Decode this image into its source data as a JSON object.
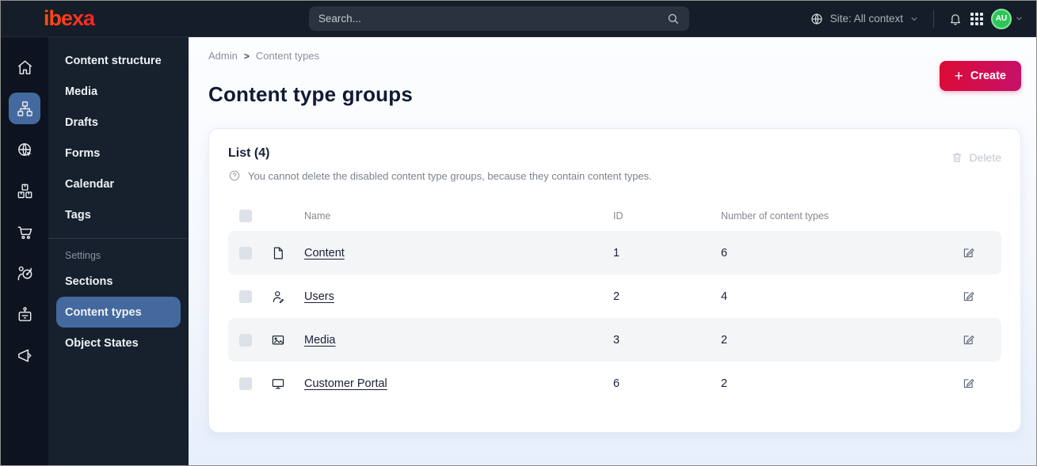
{
  "topbar": {
    "logo": "ibexa",
    "search_placeholder": "Search...",
    "site_context": "Site: All context",
    "avatar_initials": "AU",
    "icons": [
      "search-icon",
      "globe-icon",
      "chevron-down-icon",
      "bell-icon",
      "app-grid-icon"
    ]
  },
  "sidebar": {
    "rail": [
      {
        "icon": "home-icon",
        "active": false
      },
      {
        "icon": "content-structure-icon",
        "active": true
      },
      {
        "icon": "site-icon",
        "active": false
      },
      {
        "icon": "products-icon",
        "active": false
      },
      {
        "icon": "commerce-cart-icon",
        "active": false
      },
      {
        "icon": "personalization-icon",
        "active": false
      },
      {
        "icon": "admin-badge-icon",
        "active": false
      },
      {
        "icon": "campaigns-megaphone-icon",
        "active": false
      }
    ],
    "menu": {
      "items": [
        "Content structure",
        "Media",
        "Drafts",
        "Forms",
        "Calendar",
        "Tags"
      ],
      "section_label": "Settings",
      "settings_items": [
        "Sections",
        "Content types",
        "Object States"
      ],
      "active_item": "Content types"
    }
  },
  "main": {
    "breadcrumb": {
      "items": [
        "Admin",
        "Content types"
      ],
      "separator": ">"
    },
    "title": "Content type groups",
    "create_button": {
      "label": "Create",
      "icon": "plus-icon",
      "color": "#dd0a35"
    },
    "card": {
      "title": "List (4)",
      "hint": "You cannot delete the disabled content type groups, because they contain content types.",
      "hint_icon": "question-circle-icon",
      "delete_button": {
        "label": "Delete",
        "icon": "trash-icon",
        "disabled": true
      },
      "table": {
        "headers": [
          "Name",
          "ID",
          "Number of content types"
        ],
        "rows": [
          {
            "icon": "file-icon",
            "name": "Content",
            "id": "1",
            "count": "6"
          },
          {
            "icon": "user-icon",
            "name": "Users",
            "id": "2",
            "count": "4"
          },
          {
            "icon": "image-icon",
            "name": "Media",
            "id": "3",
            "count": "2"
          },
          {
            "icon": "monitor-icon",
            "name": "Customer Portal",
            "id": "6",
            "count": "2"
          }
        ],
        "row_action_icon": "edit-icon"
      }
    }
  },
  "colors": {
    "topbar_bg": "#151d28",
    "rail_bg": "#0d141f",
    "menu_bg": "#17202d",
    "active_blue": "#44699f",
    "accent_gradient": [
      "#dd0a35",
      "#c6116b"
    ],
    "avatar_green": "#2ec558",
    "row_alt_bg": "#f4f5f7",
    "text_dark": "#18203a"
  }
}
